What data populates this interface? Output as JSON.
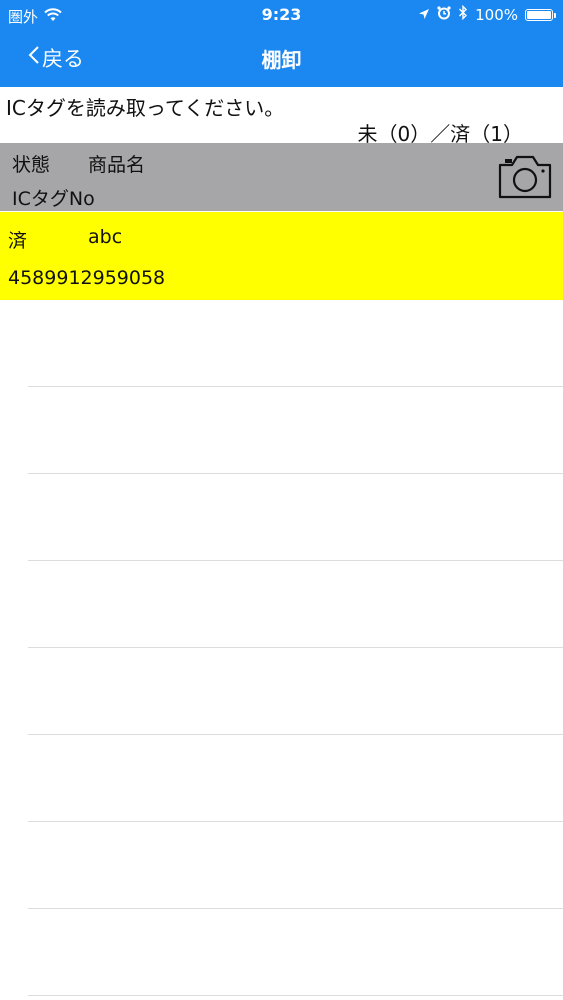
{
  "status_bar": {
    "carrier": "圏外",
    "time": "9:23",
    "battery": "100%",
    "icons": [
      "wifi-icon",
      "location-arrow-icon",
      "alarm-icon",
      "bluetooth-icon",
      "battery-icon"
    ]
  },
  "nav": {
    "back_label": "戻る",
    "title": "棚卸"
  },
  "instruction": "ICタグを読み取ってください。",
  "counts": "未（0）／済（1）",
  "header": {
    "status_label": "状態",
    "name_label": "商品名",
    "tag_label": "ICタグNo",
    "camera_icon": "camera-icon"
  },
  "items": [
    {
      "status": "済",
      "name": "abc",
      "tag_no": "4589912959058",
      "highlight_color": "#ffff00"
    }
  ],
  "colors": {
    "nav_background": "#1a88f0",
    "header_background": "#a6a6a8",
    "separator": "#dcdcdc"
  }
}
